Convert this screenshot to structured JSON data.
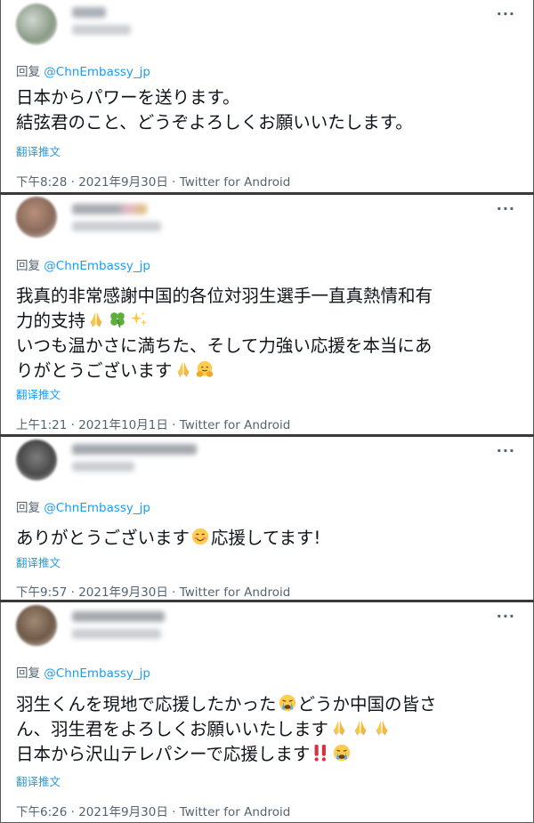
{
  "tweets": [
    {
      "reply_prefix": "回复 ",
      "reply_mention": "@ChnEmbassy_jp",
      "text_lines": [
        "日本からパワーを送ります。",
        "結弦君のこと、どうぞよろしくお願いいたします。"
      ],
      "translate": "翻译推文",
      "time": "下午8:28",
      "dot": " · ",
      "date": "2021年9月30日",
      "source": "Twitter for Android"
    },
    {
      "reply_prefix": "回复 ",
      "reply_mention": "@ChnEmbassy_jp",
      "text_lines": [
        "我真的非常感謝中国的各位対羽生選手一直真熱情和有",
        "力的支持",
        "いつも温かさに満ちた、そして力強い応援を本当にあ",
        "りがとうございます"
      ],
      "emoji_names": [
        "folded-hands-emoji",
        "four-leaf-clover-emoji",
        "sparkles-emoji",
        "folded-hands-emoji",
        "hugging-face-emoji"
      ],
      "translate": "翻译推文",
      "time": "上午1:21",
      "dot": " · ",
      "date": "2021年10月1日",
      "source": "Twitter for Android"
    },
    {
      "reply_prefix": "回复 ",
      "reply_mention": "@ChnEmbassy_jp",
      "text_lines": [
        "ありがとうございます",
        "応援してます!"
      ],
      "emoji_names": [
        "smiling-face-emoji"
      ],
      "translate": "翻译推文",
      "time": "下午9:57",
      "dot": " · ",
      "date": "2021年9月30日",
      "source": "Twitter for Android"
    },
    {
      "reply_prefix": "回复 ",
      "reply_mention": "@ChnEmbassy_jp",
      "text_lines": [
        "羽生くんを現地で応援したかった",
        "どうか中国の皆さ",
        "ん、羽生君をよろしくお願いいたします",
        "日本から沢山テレパシーで応援します"
      ],
      "emoji_names": [
        "crying-face-emoji",
        "folded-hands-emoji",
        "double-exclamation-emoji",
        "crying-face-emoji"
      ],
      "translate": "翻译推文",
      "time": "下午6:26",
      "dot": " · ",
      "date": "2021年9月30日",
      "source": "Twitter for Android"
    }
  ],
  "more_glyph": "···",
  "colors": {
    "link": "#1d9bf0",
    "muted": "#536471",
    "text": "#0f1419"
  }
}
